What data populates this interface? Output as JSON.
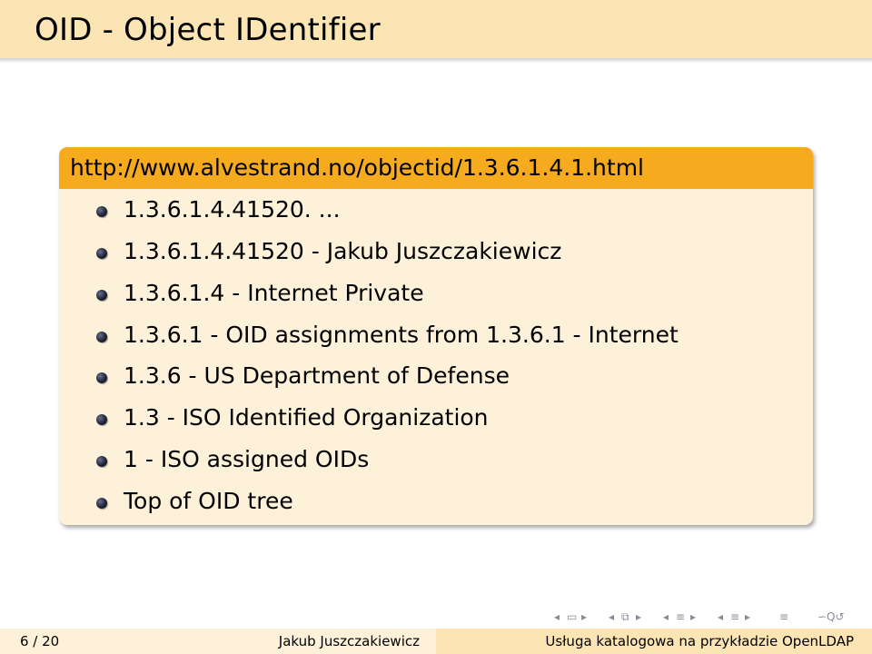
{
  "frame": {
    "title": "OID - Object IDentifier"
  },
  "block": {
    "title": "http://www.alvestrand.no/objectid/1.3.6.1.4.1.html",
    "items": [
      "1.3.6.1.4.41520. ...",
      "1.3.6.1.4.41520 - Jakub Juszczakiewicz",
      "1.3.6.1.4 - Internet Private",
      "1.3.6.1 - OID assignments from 1.3.6.1 - Internet",
      "1.3.6 - US Department of Defense",
      "1.3 - ISO Identified Organization",
      "1 - ISO assigned OIDs",
      "Top of OID tree"
    ]
  },
  "footer": {
    "page": "6 / 20",
    "author": "Jakub Juszczakiewicz",
    "title": "Usługa katalogowa na przykładzie OpenLDAP"
  },
  "colors": {
    "title_bar": "#fbe5b4",
    "block_header": "#f6ab1f",
    "block_body": "#fdf2d9",
    "footer_left": "#fdf2d9",
    "footer_right": "#fbe5b4"
  },
  "icons": {
    "nav_first": "slide-left-arrow-icon",
    "nav_frame": "frame-icon",
    "nav_subsection": "subsection-icon",
    "nav_section": "section-icon",
    "nav_doc": "document-icon",
    "nav_search": "search-icon"
  }
}
